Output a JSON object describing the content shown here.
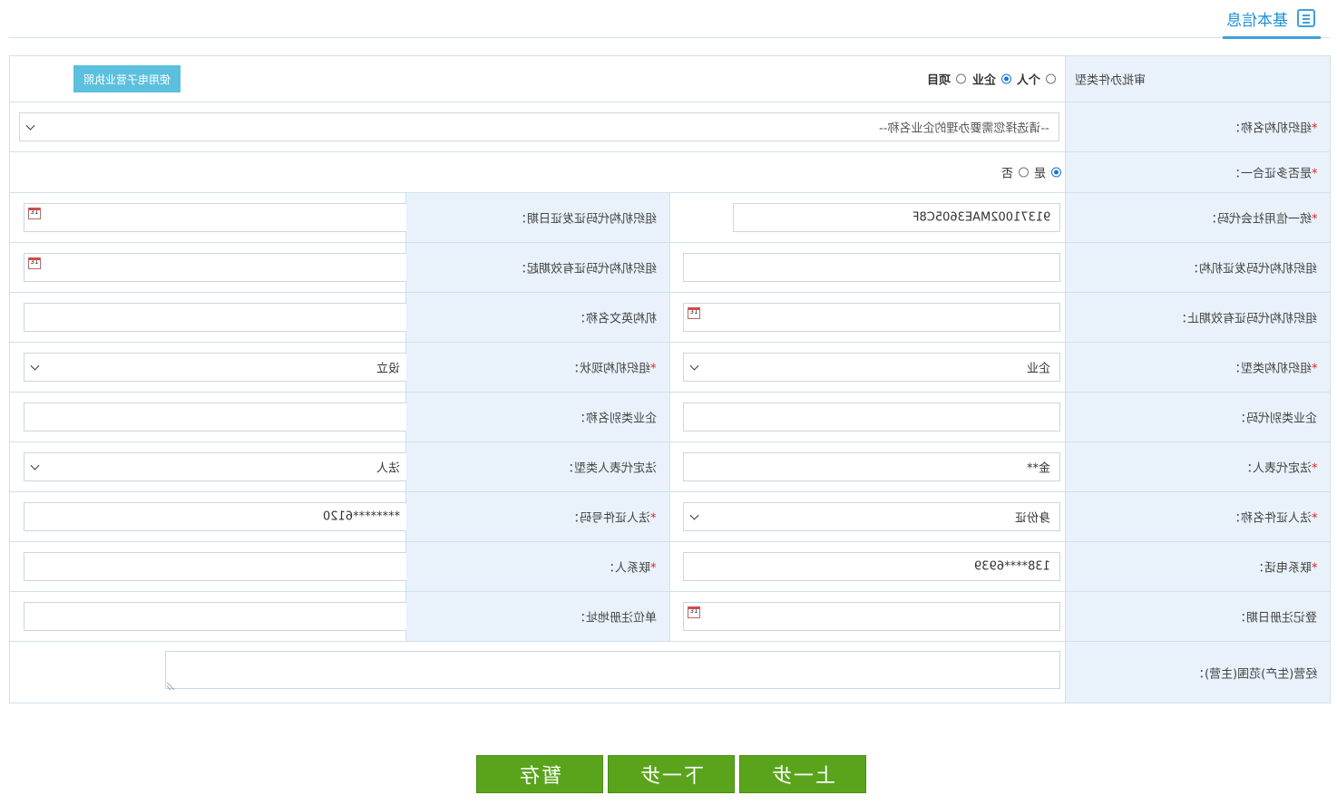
{
  "header": {
    "tab_label": "基本信息",
    "tab_icon": "list-icon"
  },
  "row_type": {
    "label": "审批办件类型",
    "options": [
      "个人",
      "企业",
      "项目"
    ],
    "selected": "企业",
    "e_license_button": "使用电子营业执照"
  },
  "org_name": {
    "label": "组织机构名称：",
    "placeholder": "--请选择您需要办理的企业名称--"
  },
  "multi_cert": {
    "label": "是否多证合一：",
    "options": [
      "是",
      "否"
    ],
    "selected": "是"
  },
  "fields": {
    "credit_code": {
      "label": "统一信用社会代码：",
      "value": "91371002MAE3605C8F",
      "required": true
    },
    "org_code_issue_date": {
      "label": "组织机构代码证发证日期：",
      "value": ""
    },
    "org_code_issuer": {
      "label": "组织机构代码发证机构：",
      "value": ""
    },
    "org_code_valid_from": {
      "label": "组织机构代码证有效期起：",
      "value": ""
    },
    "org_code_valid_to": {
      "label": "组织机构代码证有效期止：",
      "value": ""
    },
    "org_english_name": {
      "label": "机构英文名称：",
      "value": ""
    },
    "org_type": {
      "label": "组织机构类型：",
      "value": "企业",
      "required": true
    },
    "org_status": {
      "label": "组织机构现状：",
      "value": "设立",
      "required": true
    },
    "enterprise_category_code": {
      "label": "企业类别代码：",
      "value": ""
    },
    "enterprise_category_name": {
      "label": "企业类别名称：",
      "value": ""
    },
    "legal_rep": {
      "label": "法定代表人：",
      "value": "金**",
      "required": true
    },
    "legal_rep_type": {
      "label": "法定代表人类型：",
      "value": "法人"
    },
    "legal_id_name": {
      "label": "法人证件名称：",
      "value": "身份证",
      "required": true
    },
    "legal_id_number": {
      "label": "法人证件号码：",
      "value": "********6120",
      "required": true
    },
    "contact_phone": {
      "label": "联系电话：",
      "value": "138****6939",
      "required": true
    },
    "contact_person": {
      "label": "联系人：",
      "value": "",
      "required": true
    },
    "reg_date": {
      "label": "登记注册日期：",
      "value": ""
    },
    "reg_address": {
      "label": "单位注册地址：",
      "value": ""
    },
    "business_scope": {
      "label": "经营(生产)范围(主营)：",
      "value": ""
    }
  },
  "star": "*",
  "buttons": {
    "save": "暂存",
    "next": "下一步",
    "prev": "上一步"
  }
}
